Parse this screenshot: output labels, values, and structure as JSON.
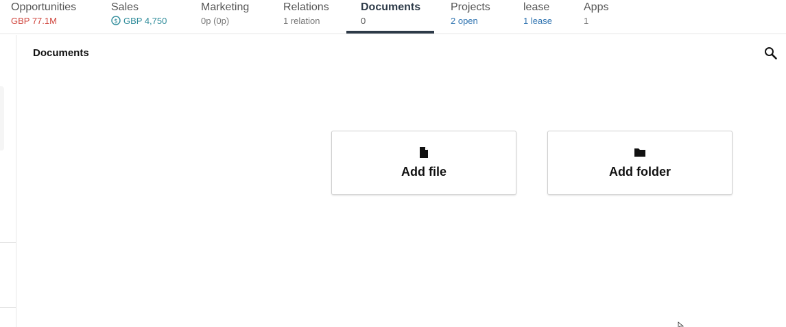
{
  "tabs": [
    {
      "label": "Opportunities",
      "sub": "GBP 77.1M"
    },
    {
      "label": "Sales",
      "sub": "GBP 4,750"
    },
    {
      "label": "Marketing",
      "sub": "0p (0p)"
    },
    {
      "label": "Relations",
      "sub": "1 relation"
    },
    {
      "label": "Documents",
      "sub": "0"
    },
    {
      "label": "Projects",
      "sub": "2 open"
    },
    {
      "label": "lease",
      "sub": "1 lease"
    },
    {
      "label": "Apps",
      "sub": "1"
    }
  ],
  "active_tab": "Documents",
  "panel": {
    "title": "Documents"
  },
  "actions": {
    "add_file_label": "Add file",
    "add_folder_label": "Add folder"
  },
  "icons": {
    "search": "search-icon",
    "file": "file-icon",
    "folder": "folder-icon",
    "coin": "coin-icon"
  },
  "colors": {
    "active_tab": "#2d3a48",
    "negative": "#d0463e",
    "teal": "#2e8b9a",
    "link_blue": "#2f73b0"
  }
}
